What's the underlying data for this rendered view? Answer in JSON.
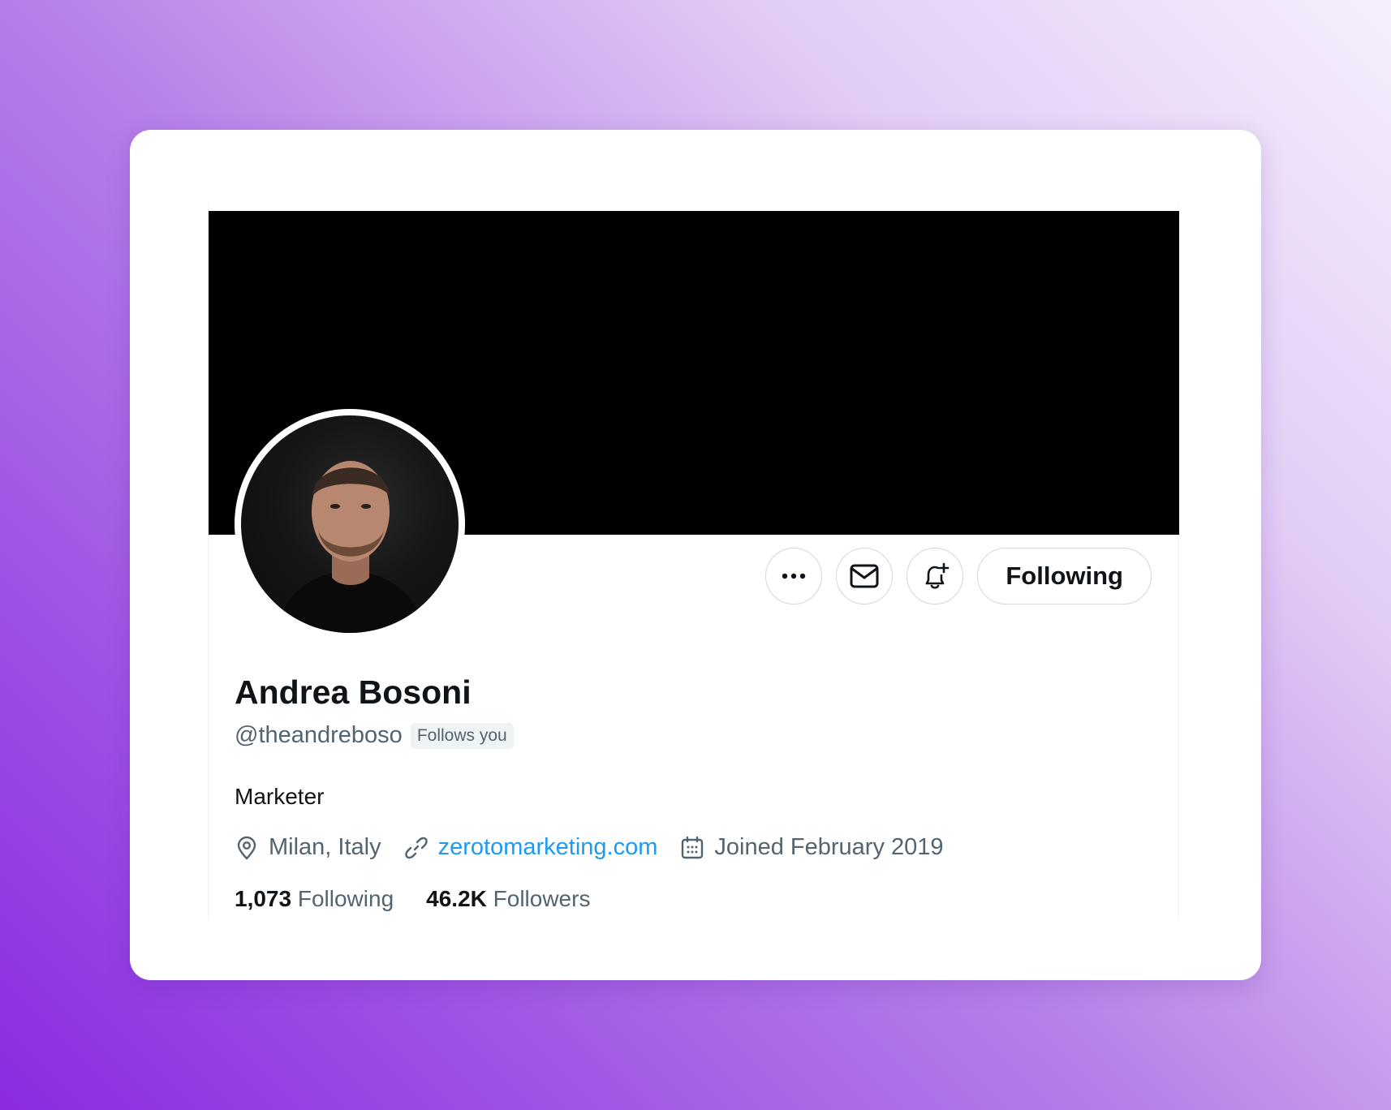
{
  "profile": {
    "name": "Andrea Bosoni",
    "handle": "@theandreboso",
    "follows_you_badge": "Follows you",
    "bio": "Marketer",
    "location": "Milan, Italy",
    "website": "zerotomarketing.com",
    "joined": "Joined February 2019"
  },
  "actions": {
    "following_label": "Following"
  },
  "stats": {
    "following_count": "1,073",
    "following_label": "Following",
    "followers_count": "46.2K",
    "followers_label": "Followers"
  },
  "colors": {
    "link": "#1d9bf0",
    "secondary_text": "#536471",
    "primary_text": "#0f1419",
    "banner": "#000000"
  },
  "icons": [
    "more-icon",
    "message-icon",
    "notification-bell-plus-icon",
    "location-pin-icon",
    "link-icon",
    "calendar-icon"
  ]
}
